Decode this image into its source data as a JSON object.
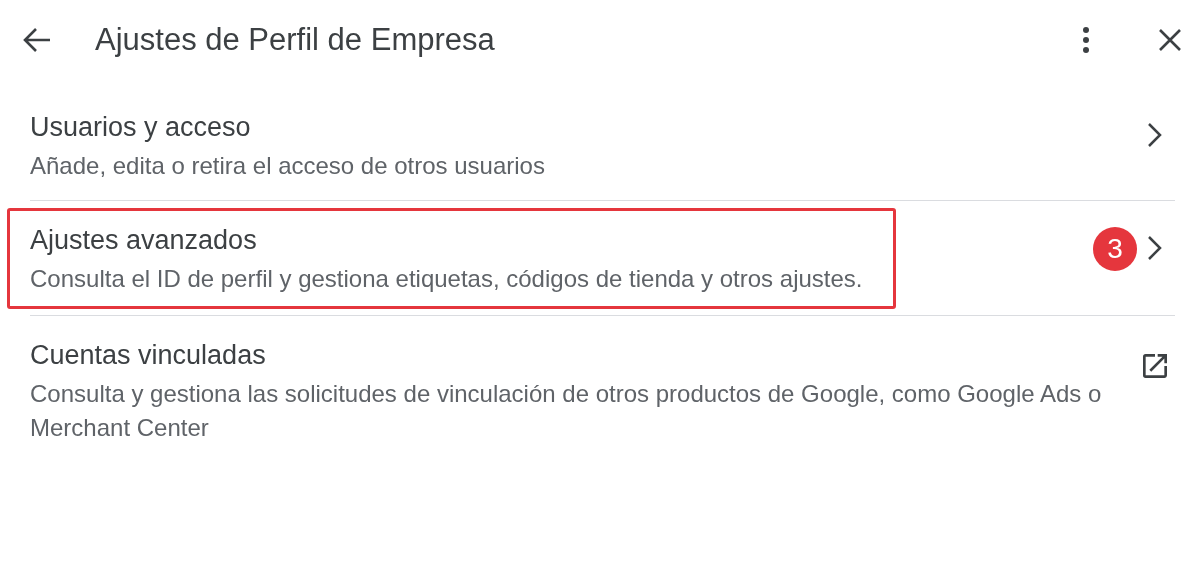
{
  "header": {
    "title": "Ajustes de Perfil de Empresa"
  },
  "items": [
    {
      "kind": "nav",
      "title": "Usuarios y acceso",
      "subtitle": "Añade, edita o retira el acceso de otros usuarios",
      "highlighted": false
    },
    {
      "kind": "nav",
      "title": "Ajustes avanzados",
      "subtitle": "Consulta el ID de perfil y gestiona etiquetas, códigos de tienda y otros ajustes.",
      "highlighted": true,
      "badge": "3"
    },
    {
      "kind": "external",
      "title": "Cuentas vinculadas",
      "subtitle": "Consulta y gestiona las solicitudes de vinculación de otros productos de Google, como Google Ads o Merchant Center",
      "highlighted": false
    }
  ]
}
